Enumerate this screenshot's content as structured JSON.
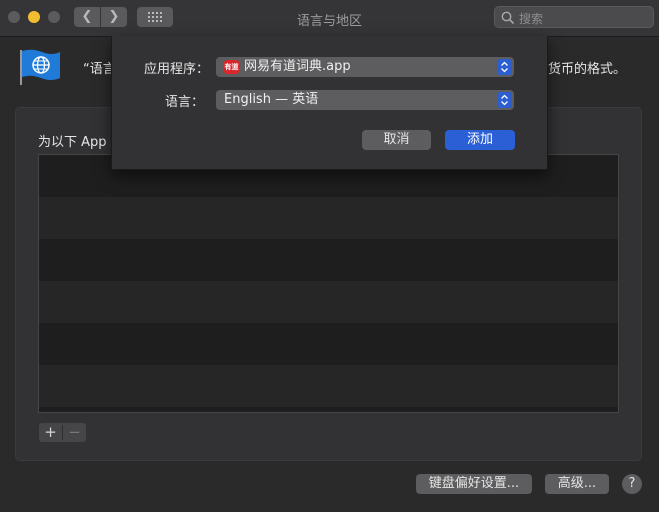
{
  "window": {
    "title": "语言与地区",
    "search_placeholder": "搜索"
  },
  "header": {
    "text_left": "“语言",
    "text_right": "货币的格式。"
  },
  "group": {
    "title": "为以下 App I",
    "add_label": "+",
    "remove_label": "−"
  },
  "bottom": {
    "keyboard_button": "键盘偏好设置...",
    "advanced_button": "高级...",
    "help_button": "?"
  },
  "sheet": {
    "app_label": "应用程序：",
    "app_value": "网易有道词典.app",
    "app_icon_text": "有道",
    "language_label": "语言：",
    "language_value": "English — 英语",
    "cancel_button": "取消",
    "add_button": "添加"
  },
  "colors": {
    "accent": "#2a5fd6",
    "window_bg": "#2b2a2b",
    "minimize": "#f2be31"
  }
}
